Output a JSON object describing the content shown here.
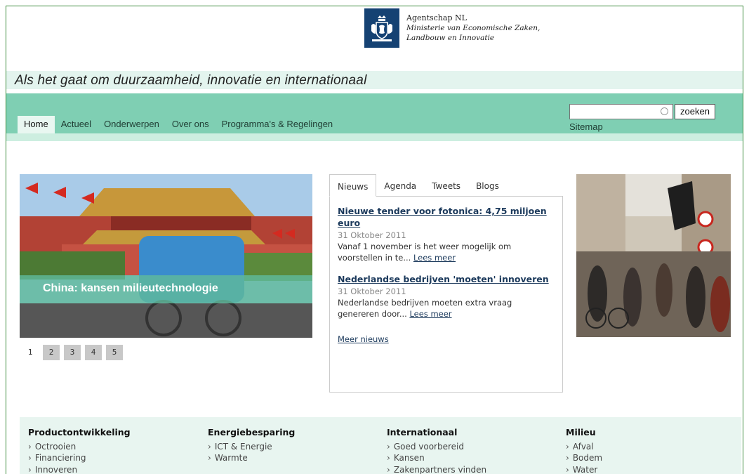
{
  "header": {
    "org_name": "Agentschap NL",
    "ministry_line1": "Ministerie van Economische Zaken,",
    "ministry_line2": "Landbouw en Innovatie"
  },
  "tagline": "Als het gaat om duurzaamheid, innovatie en internationaal",
  "nav": {
    "items": [
      {
        "label": "Home",
        "active": true
      },
      {
        "label": "Actueel"
      },
      {
        "label": "Onderwerpen"
      },
      {
        "label": "Over ons"
      },
      {
        "label": "Programma's & Regelingen"
      }
    ],
    "search_value": "",
    "search_button": "zoeken",
    "sitemap": "Sitemap"
  },
  "hero": {
    "caption": "China: kansen milieutechnologie",
    "pages": [
      "1",
      "2",
      "3",
      "4",
      "5"
    ],
    "current_page": 1
  },
  "news": {
    "tabs": [
      "Nieuws",
      "Agenda",
      "Tweets",
      "Blogs"
    ],
    "articles": [
      {
        "title": "Nieuwe tender voor fotonica: 4,75 miljoen euro",
        "date": "31 Oktober 2011",
        "summary": "Vanaf 1 november is het weer mogelijk om voorstellen in te...",
        "read_more": "Lees meer"
      },
      {
        "title": "Nederlandse bedrijven 'moeten' innoveren",
        "date": "31 Oktober 2011",
        "summary": "Nederlandse bedrijven moeten extra vraag genereren door...",
        "read_more": "Lees meer"
      }
    ],
    "more_news": "Meer nieuws"
  },
  "footer": {
    "columns": [
      {
        "heading": "Productontwikkeling",
        "links": [
          "Octrooien",
          "Financiering",
          "Innoveren"
        ]
      },
      {
        "heading": "Energiebesparing",
        "links": [
          "ICT & Energie",
          "Warmte"
        ]
      },
      {
        "heading": "Internationaal",
        "links": [
          "Goed voorbereid",
          "Kansen",
          "Zakenpartners vinden"
        ]
      },
      {
        "heading": "Milieu",
        "links": [
          "Afval",
          "Bodem",
          "Water"
        ]
      }
    ]
  },
  "colors": {
    "nav_band": "#7fcfb3",
    "tagline_band": "#e3f4ee",
    "logo_blue": "#154273",
    "link": "#1c3a5c"
  }
}
